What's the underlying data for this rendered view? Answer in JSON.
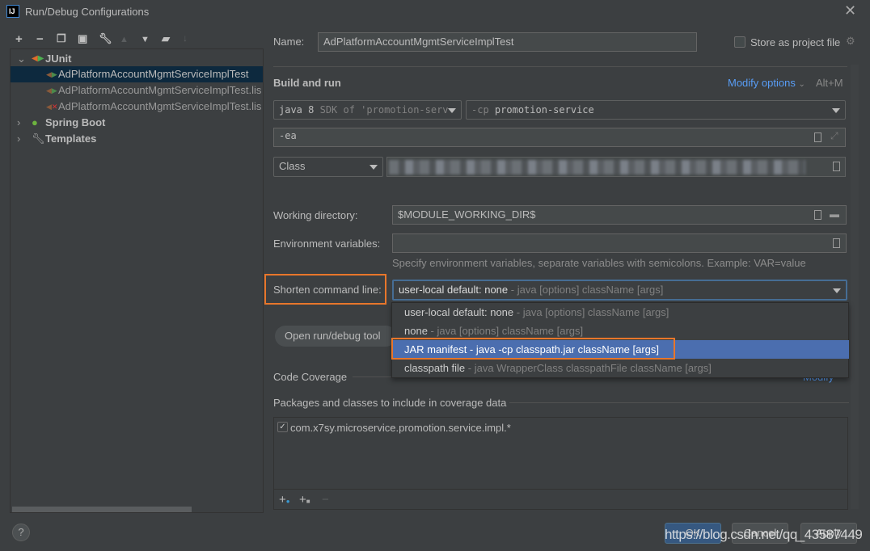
{
  "window": {
    "title": "Run/Debug Configurations",
    "app_icon": "intellij-icon",
    "close_icon": "close-icon"
  },
  "toolbar": {
    "icons": [
      "plus-icon",
      "minus-icon",
      "copy-icon",
      "save-icon",
      "wrench-icon",
      "arrow-up-icon",
      "arrow-down-icon",
      "new-folder-icon",
      "sort-icon"
    ]
  },
  "tree": {
    "junit": {
      "label": "JUnit",
      "children": [
        "AdPlatformAccountMgmtServiceImplTest",
        "AdPlatformAccountMgmtServiceImplTest.lis",
        "AdPlatformAccountMgmtServiceImplTest.lis"
      ]
    },
    "spring_boot": "Spring Boot",
    "templates": "Templates"
  },
  "form": {
    "name_label": "Name:",
    "name_value": "AdPlatformAccountMgmtServiceImplTest",
    "store_label": "Store as project file",
    "store_checked": false,
    "build_run": "Build and run",
    "modify_options": "Modify options",
    "modify_shortcut": "Alt+M",
    "jre_main": "java 8",
    "jre_hint": "SDK of 'promotion-serv",
    "cp_prefix": "-cp",
    "cp_value": "promotion-service",
    "vm_options": "-ea",
    "class_kind": "Class",
    "working_dir_label": "Working directory:",
    "working_dir_value": "$MODULE_WORKING_DIR$",
    "env_label": "Environment variables:",
    "env_value": "",
    "env_hint": "Specify environment variables, separate variables with semicolons. Example: VAR=value",
    "shorten_label": "Shorten command line:",
    "shorten_value": "user-local default: none",
    "shorten_hint": " - java [options] className [args]",
    "open_tool": "Open run/debug tool",
    "code_coverage": "Code Coverage",
    "modify_link": "Modify",
    "packages_label": "Packages and classes to include in coverage data",
    "package_entry": "com.x7sy.microservice.promotion.service.impl.*",
    "package_checked": true
  },
  "dropdown": {
    "options": [
      {
        "main": "user-local default: none",
        "hint": " - java [options] className [args]"
      },
      {
        "main": "none",
        "hint": " - java [options] className [args]"
      },
      {
        "main": "JAR manifest - java -cp classpath.jar className [args]",
        "hint": ""
      },
      {
        "main": "classpath file",
        "hint": " - java WrapperClass classpathFile className [args]"
      }
    ],
    "selected_index": 2
  },
  "buttons": {
    "ok": "OK",
    "cancel": "Cancel",
    "apply": "Apply",
    "help": "?"
  },
  "watermark": "https://blog.csdn.net/qq_43587449",
  "colors": {
    "bg": "#3c3f41",
    "accent": "#4b6eaf",
    "link": "#589df6",
    "highlight": "#e8762b"
  }
}
